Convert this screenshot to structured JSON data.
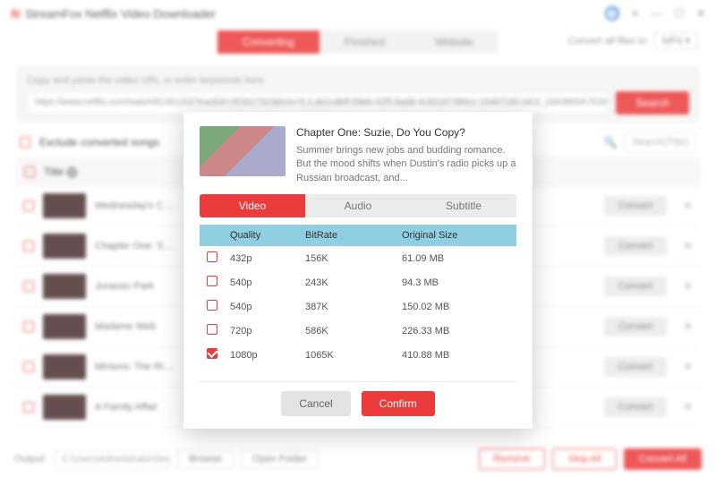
{
  "app": {
    "title": "StreamFox Netflix Video Downloader",
    "logo": "N"
  },
  "window_icons": {
    "menu": "≡",
    "min": "—",
    "max": "☐",
    "close": "✕"
  },
  "main_tabs": {
    "converting": "Converting",
    "finished": "Finished",
    "website": "Website"
  },
  "convert_all": {
    "label": "Convert all files to:",
    "value": "MP4 ▾"
  },
  "search": {
    "label": "Copy and paste the video URL or enter keywords here",
    "value": "https://www.netflix.com/watch/81361154?trackid=262617323&tctx=5,1,ab1cdbff-09bb-42f5-bad8-4c65167390cc-15497190,NES_18A3865A7633BA8851",
    "btn": "Search"
  },
  "filters": {
    "exclude": "Exclude converted songs",
    "search_ph": "Search(Title)"
  },
  "thead": {
    "title": "Title ⨁"
  },
  "rows": [
    {
      "title": "Wednesday's Chil..."
    },
    {
      "title": "Chapter One: Suz..."
    },
    {
      "title": "Jurassic Park"
    },
    {
      "title": "Madame Web"
    },
    {
      "title": "Minions: The Rise..."
    },
    {
      "title": "A Family Affair"
    }
  ],
  "row_btn": "Convert",
  "footer": {
    "output": "Output:",
    "path": "C:\\Users\\Administrator\\Stre...",
    "browse": "Browse",
    "open": "Open Folder",
    "remove": "Remove",
    "stop": "Stop All",
    "convert": "Convert All"
  },
  "dialog": {
    "title": "Chapter One: Suzie, Do You Copy?",
    "desc": "Summer brings new jobs and budding romance. But the mood shifts when Dustin's radio picks up a Russian broadcast, and...",
    "tabs": {
      "video": "Video",
      "audio": "Audio",
      "subtitle": "Subtitle"
    },
    "head": {
      "quality": "Quality",
      "bitrate": "BitRate",
      "size": "Original Size"
    },
    "options": [
      {
        "quality": "432p",
        "bitrate": "156K",
        "size": "61.09 MB",
        "checked": false
      },
      {
        "quality": "540p",
        "bitrate": "243K",
        "size": "94.3 MB",
        "checked": false
      },
      {
        "quality": "540p",
        "bitrate": "387K",
        "size": "150.02 MB",
        "checked": false
      },
      {
        "quality": "720p",
        "bitrate": "586K",
        "size": "226.33 MB",
        "checked": false
      },
      {
        "quality": "1080p",
        "bitrate": "1065K",
        "size": "410.88 MB",
        "checked": true
      }
    ],
    "cancel": "Cancel",
    "confirm": "Confirm"
  }
}
